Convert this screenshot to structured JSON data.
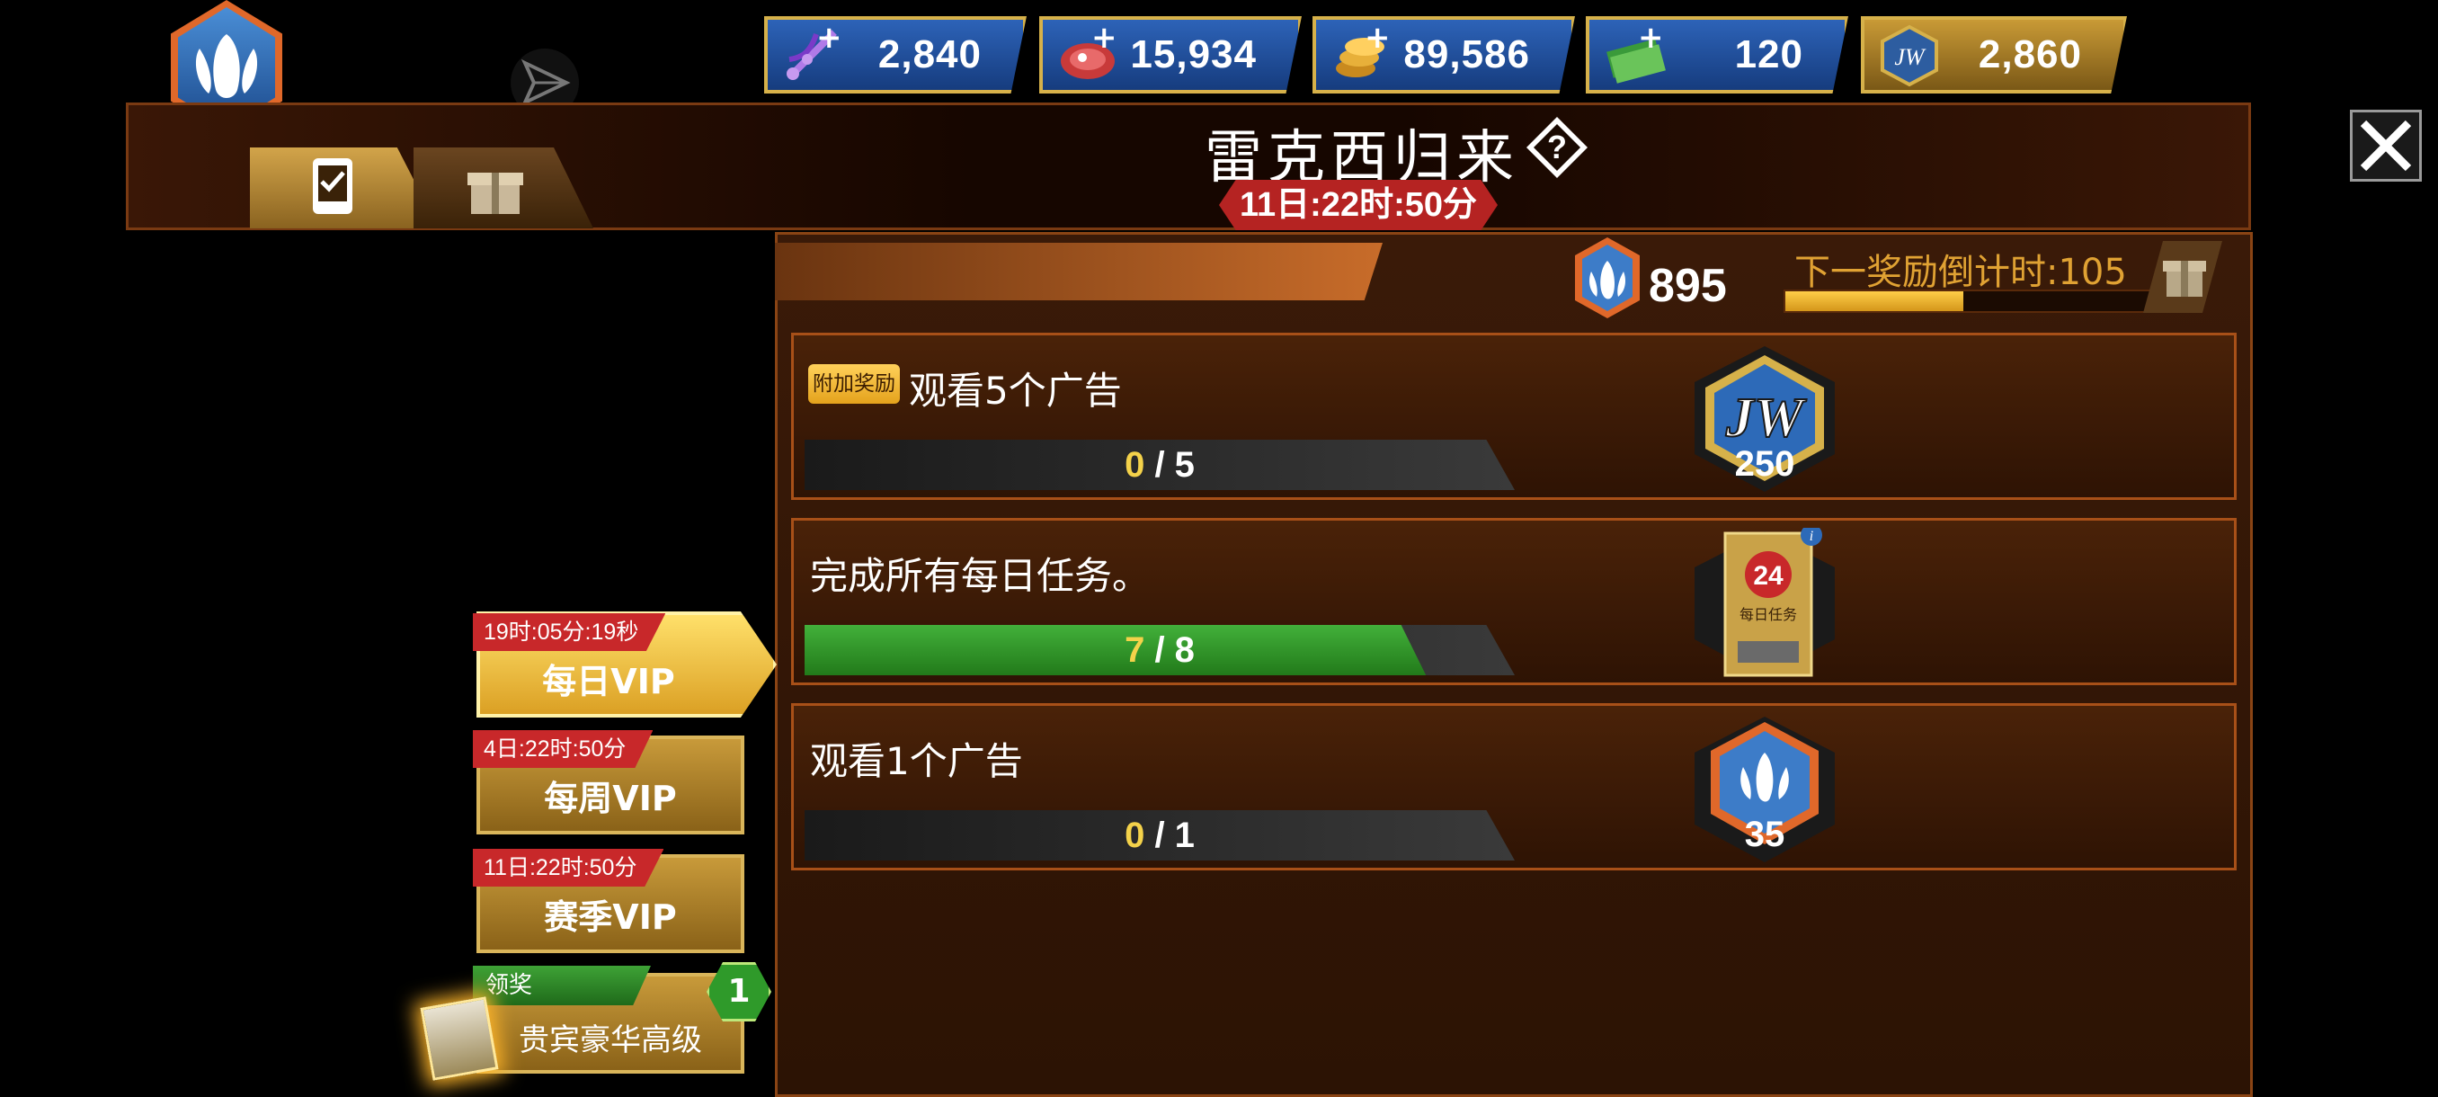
{
  "currencies": [
    {
      "name": "dna",
      "value": "2,840",
      "icon": "dna-icon"
    },
    {
      "name": "food",
      "value": "15,934",
      "icon": "meat-icon"
    },
    {
      "name": "coins",
      "value": "89,586",
      "icon": "coins-icon"
    },
    {
      "name": "cash",
      "value": "120",
      "icon": "cash-icon"
    },
    {
      "name": "jw_points",
      "value": "2,860",
      "icon": "jw-logo-icon"
    }
  ],
  "event": {
    "title": "雷克西归来",
    "timer": "11日:22时:50分",
    "points": "895",
    "next_reward_label": "下一奖励倒计时:105",
    "next_reward_progress": 0.48
  },
  "tasks": [
    {
      "badge": "附加奖励",
      "title": "观看5个广告",
      "current": "0",
      "total": "5",
      "progress": 0.0,
      "reward_amount": "250",
      "reward_icon": "jw-logo-icon"
    },
    {
      "badge": "",
      "title": "完成所有每日任务。",
      "current": "7",
      "total": "8",
      "progress": 0.875,
      "reward_amount": "",
      "reward_icon": "daily-task-card-icon",
      "card_number": "24",
      "card_label": "每日任务"
    },
    {
      "badge": "",
      "title": "观看1个广告",
      "current": "0",
      "total": "1",
      "progress": 0.0,
      "reward_amount": "35",
      "reward_icon": "event-points-icon"
    }
  ],
  "vip": [
    {
      "timer": "19时:05分:19秒",
      "label": "每日VIP",
      "active": true
    },
    {
      "timer": "4日:22时:50分",
      "label": "每周VIP",
      "active": false
    },
    {
      "timer": "11日:22时:50分",
      "label": "赛季VIP",
      "active": false
    }
  ],
  "premium": {
    "claim_label": "领奖",
    "claim_count": "1",
    "label": "贵宾豪华高级"
  },
  "colors": {
    "accent_orange": "#e0682a",
    "panel_border": "#a85018",
    "progress_green": "#42b03a",
    "timer_red": "#c8282a",
    "gold": "#d6b14a"
  }
}
